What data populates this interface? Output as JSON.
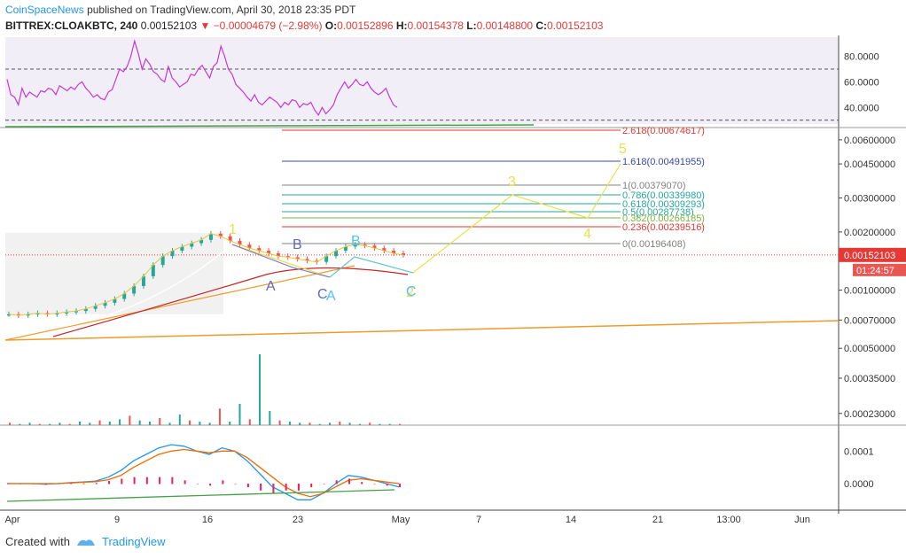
{
  "header": {
    "author": "CoinSpaceNews",
    "published": "published on TradingView.com, April 30, 2018 23:35 PDT",
    "symbol": "BITTREX:CLOAKBTC, 240",
    "last": "0.00152103",
    "change": "−0.00004679 (−2.98%)",
    "open_label": "O:",
    "open": "0.00152896",
    "high_label": "H:",
    "high": "0.00154378",
    "low_label": "L:",
    "low": "0.00148800",
    "close_label": "C:",
    "close": "0.00152103"
  },
  "footer": {
    "created_with": "Created with",
    "brand": "TradingView"
  },
  "chart_data": [
    {
      "type": "line",
      "panel": "rsi",
      "y_ticks": [
        "80.0000",
        "60.0000",
        "40.0000"
      ],
      "bands": [
        70,
        30
      ],
      "ylim": [
        27,
        95
      ],
      "series": [
        {
          "values": [
            62,
            50,
            48,
            42,
            55,
            48,
            52,
            50,
            48,
            53,
            52,
            55,
            54,
            50,
            57,
            55,
            53,
            56,
            54,
            58,
            60,
            55,
            52,
            48,
            50,
            47,
            46,
            52,
            54,
            62,
            70,
            68,
            72,
            80,
            92,
            82,
            70,
            78,
            74,
            68,
            66,
            62,
            60,
            72,
            63,
            60,
            56,
            58,
            60,
            66,
            65,
            70,
            73,
            68,
            63,
            72,
            75,
            88,
            80,
            70,
            66,
            58,
            55,
            52,
            48,
            45,
            50,
            44,
            42,
            45,
            48,
            46,
            44,
            40,
            44,
            42,
            46,
            45,
            40,
            43,
            42,
            44,
            38,
            34,
            40,
            35,
            38,
            42,
            50,
            55,
            60,
            55,
            58,
            62,
            58,
            57,
            60,
            55,
            52,
            50,
            52,
            55,
            48,
            42,
            40
          ]
        }
      ]
    },
    {
      "type": "candlestick",
      "panel": "price",
      "y_ticks": [
        "0.00600000",
        "0.00450000",
        "0.00300000",
        "0.00200000",
        "0.00100000",
        "0.00070000",
        "0.00050000",
        "0.00035000",
        "0.00023000"
      ],
      "x_ticks": [
        "Apr",
        "9",
        "16",
        "23",
        "May",
        "7",
        "14",
        "21",
        "13:00",
        "Jun"
      ],
      "last_price": "0.00152103",
      "countdown": "01:24:57",
      "fib_levels": [
        {
          "label": "2.618(0.00674617)",
          "color": "#e53935"
        },
        {
          "label": "1.618(0.00491955)",
          "color": "#3949ab"
        },
        {
          "label": "1(0.00379070)",
          "color": "#808080"
        },
        {
          "label": "0.786(0.00339980)",
          "color": "#26a69a"
        },
        {
          "label": "0.618(0.00309293)",
          "color": "#26a69a"
        },
        {
          "label": "0.5(0.00287738)",
          "color": "#26a69a"
        },
        {
          "label": "0.382(0.00266185)",
          "color": "#7cb342"
        },
        {
          "label": "0.236(0.00239516)",
          "color": "#e53935"
        },
        {
          "label": "0(0.00196408)",
          "color": "#808080"
        }
      ],
      "wave_labels": [
        "1",
        "2",
        "3",
        "4",
        "5",
        "A",
        "B",
        "C",
        "A",
        "B",
        "C"
      ],
      "series": [
        {
          "name": "price",
          "values": [
            0.00075,
            0.00074,
            0.00075,
            0.00076,
            0.00075,
            0.00076,
            0.00077,
            0.00078,
            0.0008,
            0.00083,
            0.00086,
            0.0009,
            0.00096,
            0.00105,
            0.00118,
            0.00135,
            0.0015,
            0.0016,
            0.00168,
            0.00175,
            0.00182,
            0.00196,
            0.0019,
            0.0018,
            0.00172,
            0.00165,
            0.0016,
            0.00155,
            0.0015,
            0.00148,
            0.00145,
            0.00142,
            0.0014,
            0.0015,
            0.0016,
            0.00168,
            0.00172,
            0.0017,
            0.00165,
            0.0016,
            0.00155,
            0.00152
          ]
        }
      ]
    },
    {
      "type": "bar",
      "panel": "volume",
      "series": [
        {
          "values": [
            2,
            1,
            2,
            1,
            1,
            2,
            1,
            3,
            2,
            4,
            3,
            5,
            8,
            4,
            3,
            6,
            2,
            9,
            4,
            3,
            2,
            14,
            3,
            18,
            5,
            60,
            12,
            4,
            3,
            2,
            2,
            1,
            2,
            3,
            2,
            1,
            2,
            1,
            1,
            1
          ]
        }
      ]
    },
    {
      "type": "line",
      "panel": "macd",
      "y_ticks": [
        "0.0001",
        "0.0000"
      ],
      "series": [
        {
          "values": [
            0,
            0,
            0,
            -2e-06,
            0,
            3e-06,
            5e-06,
            8e-06,
            2e-05,
            4e-05,
            7e-05,
            9e-05,
            0.00011,
            0.00012,
            0.000115,
            0.0001,
            9e-05,
            0.00011,
            0.0001,
            7e-05,
            3e-05,
            -1e-05,
            -3e-05,
            -5e-05,
            -5e-05,
            -3e-05,
            0,
            2.5e-05,
            2e-05,
            1e-05,
            0,
            -1e-05
          ]
        },
        {
          "values": [
            0,
            0,
            0,
            0,
            0,
            2e-06,
            4e-06,
            6e-06,
            1.2e-05,
            2.5e-05,
            5e-05,
            7e-05,
            9e-05,
            0.0001,
            0.000105,
            0.0001,
            9.5e-05,
            0.0001,
            0.0001,
            8e-05,
            5e-05,
            2e-05,
            -1e-05,
            -3e-05,
            -4e-05,
            -3e-05,
            -1e-05,
            1e-05,
            1.5e-05,
            1e-05,
            5e-06,
            0
          ]
        }
      ]
    }
  ]
}
